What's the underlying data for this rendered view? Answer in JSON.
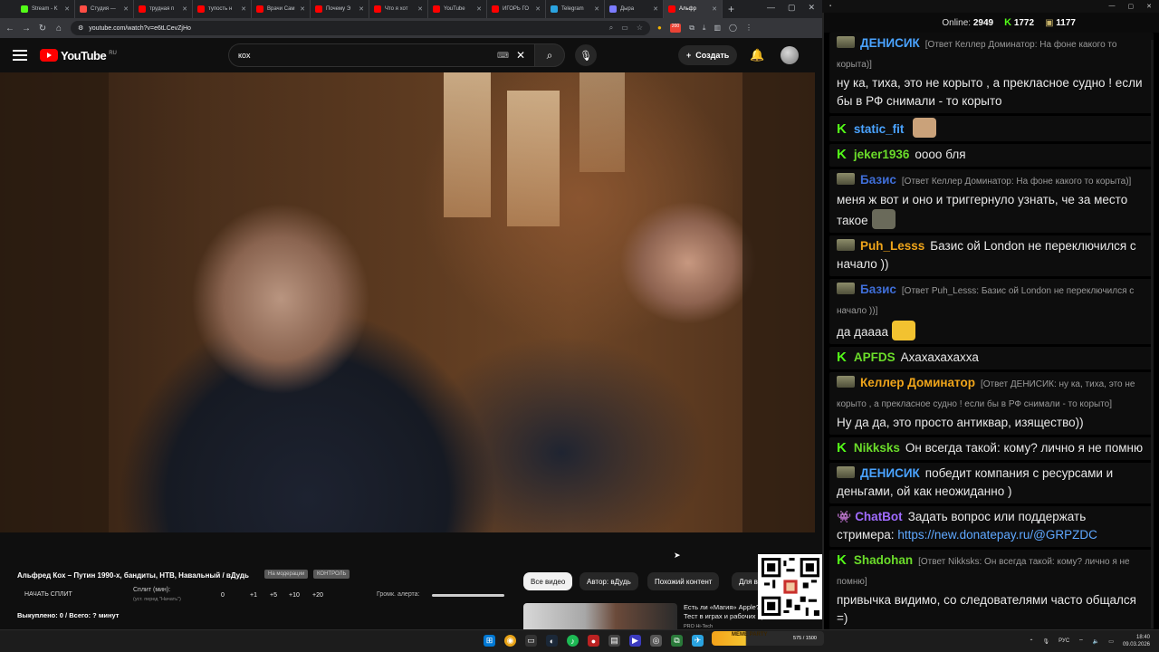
{
  "browser": {
    "tabs": [
      {
        "title": "Stream - K",
        "color": "#53fc18",
        "active": false
      },
      {
        "title": "Студия —",
        "color": "#ff4e45",
        "active": false
      },
      {
        "title": "трудная п",
        "color": "#ff0000",
        "active": false
      },
      {
        "title": "тупость н",
        "color": "#ff0000",
        "active": false
      },
      {
        "title": "Врачи Сам",
        "color": "#ff0000",
        "active": false
      },
      {
        "title": "Почему Э",
        "color": "#ff0000",
        "active": false
      },
      {
        "title": "Что я хот",
        "color": "#ff0000",
        "active": false
      },
      {
        "title": "YouTube",
        "color": "#ff0000",
        "active": false
      },
      {
        "title": "ИГОРЬ ГО",
        "color": "#ff0000",
        "active": false
      },
      {
        "title": "Telegram",
        "color": "#2aa3e0",
        "active": false
      },
      {
        "title": "Дыра",
        "color": "#7c7cff",
        "active": false
      },
      {
        "title": "Альфр",
        "color": "#ff0000",
        "active": true
      }
    ],
    "url": "youtube.com/watch?v=e6tLCevZjHo",
    "ext_badge": "200"
  },
  "youtube": {
    "logo_word": "YouTube",
    "region": "RU",
    "search_value": "кох",
    "create_label": "Создать"
  },
  "video": {
    "title": "Альфред Кох – Путин 1990-х, бандиты, НТВ, Навальный / вДудь",
    "tag1": "На модерации",
    "tag2": "КОНТРОЛЬ"
  },
  "split": {
    "start_label": "НАЧАТЬ СПЛИТ",
    "minutes_label": "Сплит (мин):",
    "minutes_hint": "(уст. перед \"Начать\")",
    "values": [
      "0",
      "+1",
      "+5",
      "+10",
      "+20"
    ],
    "alert_label": "Громк. алерта:",
    "bought": "Выкуплено: 0 / Всего: ? минут"
  },
  "chips": [
    "Все видео",
    "Автор: вДудь",
    "Похожий контент",
    "Для вас"
  ],
  "recommendation": {
    "title": "Есть ли «Магия» Apple? Тест в играх и рабочих пр...",
    "meta": "PRO Hi-Tech"
  },
  "chat": {
    "online_label": "Online:",
    "online_count": "2949",
    "kick_count": "1772",
    "other_count": "1177",
    "messages": [
      {
        "badge": "sub",
        "user": "ДЕНИСИК",
        "color": "#4aa3ff",
        "reply": "[Ответ Келлер Доминатор: На фоне какого то корыта)]",
        "text": "ну ка, тиха, это не корыто , а прекласное судно ! если бы в РФ снимали - то корыто"
      },
      {
        "badge": "kick",
        "user": "static_fit",
        "color": "#4aa3ff",
        "reply": "",
        "text": "",
        "emote": "#caa27a"
      },
      {
        "badge": "kick",
        "user": "jeker1936",
        "color": "#6bdc2a",
        "reply": "",
        "text": "оооо бля"
      },
      {
        "badge": "sub",
        "user": "Базис",
        "color": "#3f6ed8",
        "reply": "[Ответ Келлер Доминатор: На фоне какого то корыта)]",
        "text": "меня ж вот и оно и триггернуло узнать, че за место такое",
        "emote": "#6a6a5a"
      },
      {
        "badge": "sub",
        "user": "Puh_Lesss",
        "color": "#f0a51a",
        "reply": "",
        "text": "Базис ой London не переключился с начало ))"
      },
      {
        "badge": "sub",
        "user": "Базис",
        "color": "#3f6ed8",
        "reply": "[Ответ Puh_Lesss: Базис ой London не переключился с начало ))]",
        "text": "да даааа",
        "emote": "#f2c230"
      },
      {
        "badge": "kick",
        "user": "APFDS",
        "color": "#6bdc2a",
        "reply": "",
        "text": "Ахахахахахха"
      },
      {
        "badge": "sub",
        "user": "Келлер Доминатор",
        "color": "#f0a51a",
        "reply": "[Ответ ДЕНИСИК: ну ка, тиха, это не корыто , а прекласное судно ! если бы в РФ снимали - то корыто]",
        "text": "Ну да да, это просто антиквар, изящество))"
      },
      {
        "badge": "kick",
        "user": "Nikksks",
        "color": "#6bdc2a",
        "reply": "",
        "text": "Он всегда такой: кому? лично я не помню"
      },
      {
        "badge": "sub",
        "user": "ДЕНИСИК",
        "color": "#4aa3ff",
        "reply": "",
        "text": "победит компания с ресурсами и деньгами, ой как неожиданно )"
      },
      {
        "badge": "bot",
        "user": "ChatBot",
        "color": "#a06bff",
        "reply": "",
        "text": "Задать вопрос или поддержать стримера:",
        "link": "https://new.donatepay.ru/@GRPZDC"
      },
      {
        "badge": "kick",
        "user": "Shadohan",
        "color": "#6bdc2a",
        "reply": "[Ответ Nikksks: Он всегда такой: кому? лично я не помню]",
        "text": "привычка видимо, со следователями часто общался =)"
      }
    ]
  },
  "taskbar": {
    "stream_widget_label": "MEME PARTY",
    "stream_widget_value": "575 / 1500",
    "lang": "РУС",
    "time": "18:40",
    "date": "09.03.2026"
  }
}
